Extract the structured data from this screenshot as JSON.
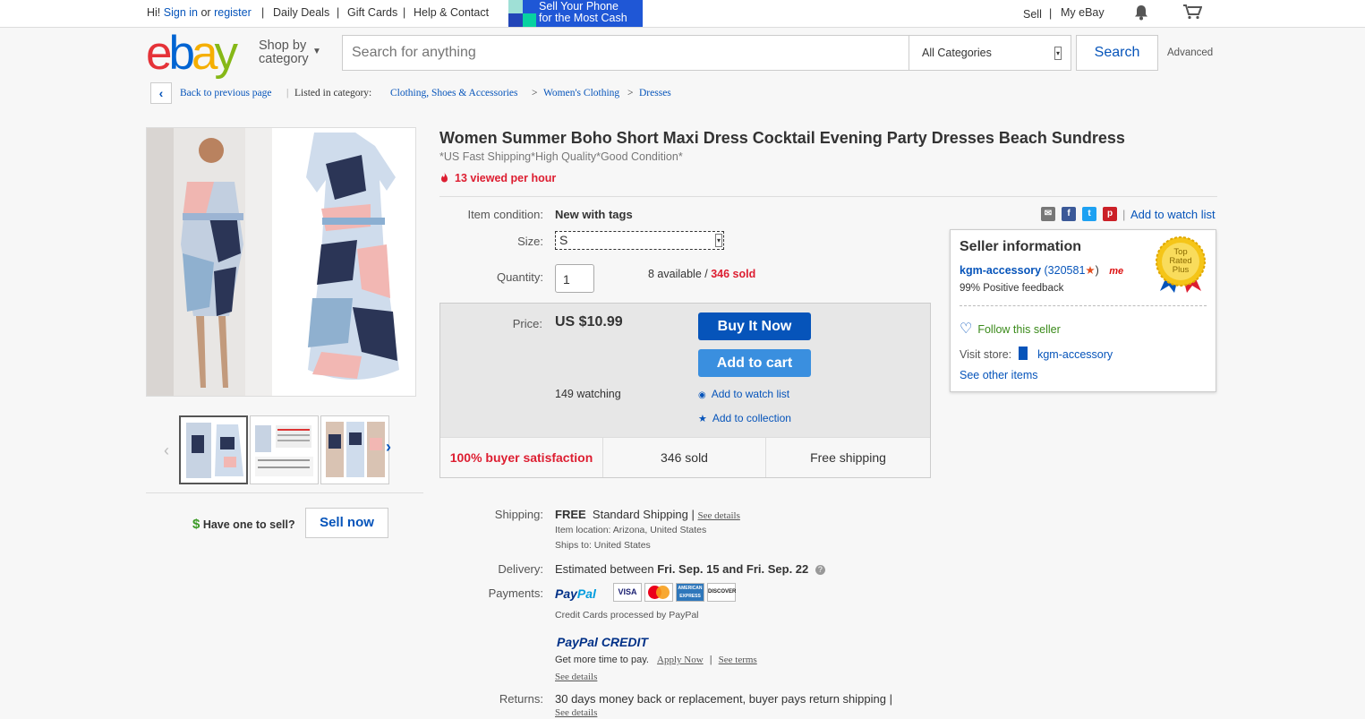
{
  "topbar": {
    "greeting": "Hi!",
    "sign_in": "Sign in",
    "or": "or",
    "register": "register",
    "links": [
      "Daily Deals",
      "Gift Cards",
      "Help & Contact"
    ],
    "banner": "Sell Your Phone for the Most Cash",
    "banner_line1": "Sell Your Phone",
    "banner_line2": "for the Most Cash",
    "sell": "Sell",
    "my_ebay": "My eBay"
  },
  "header": {
    "logo": "ebay",
    "shop_by_1": "Shop by",
    "shop_by_2": "category",
    "search_placeholder": "Search for anything",
    "category": "All Categories",
    "search_button": "Search",
    "advanced": "Advanced"
  },
  "breadcrumb": {
    "back": "Back to previous page",
    "listed_in": "Listed in category:",
    "items": [
      "Clothing, Shoes & Accessories",
      "Women's Clothing",
      "Dresses"
    ]
  },
  "gallery": {
    "have_one": "Have one to sell?",
    "sell_now": "Sell now"
  },
  "item": {
    "title": "Women Summer Boho Short Maxi Dress Cocktail Evening Party Dresses Beach Sundress",
    "subtitle": "*US Fast Shipping*High Quality*Good Condition*",
    "viewed": "13 viewed per hour",
    "condition_label": "Item condition:",
    "condition": "New with tags",
    "size_label": "Size:",
    "size_value": "S",
    "quantity_label": "Quantity:",
    "quantity": "1",
    "available": "8 available",
    "slash": "/",
    "sold": "346 sold",
    "watch_list_top": "Add to watch list"
  },
  "buybox": {
    "price_label": "Price:",
    "price": "US $10.99",
    "buy_now": "Buy It Now",
    "add_cart": "Add to cart",
    "watching": "149 watching",
    "add_watch": "Add to watch list",
    "add_collection": "Add to collection",
    "satisfaction": "100% buyer satisfaction",
    "sold": "346 sold",
    "free_shipping": "Free shipping"
  },
  "seller": {
    "heading": "Seller information",
    "name": "kgm-accessory",
    "score": "(320581",
    "score_close": ")",
    "me": "me",
    "feedback": "99% Positive feedback",
    "badge_1": "Top",
    "badge_2": "Rated",
    "badge_3": "Plus",
    "follow": "Follow this seller",
    "visit_store": "Visit store:",
    "store": "kgm-accessory",
    "see_other": "See other items"
  },
  "details": {
    "shipping_label": "Shipping:",
    "shipping_free": "FREE",
    "shipping_method": "Standard Shipping |",
    "see_details": "See details",
    "item_location": "Item location:  Arizona, United States",
    "ships_to": "Ships to:  United States",
    "delivery_label": "Delivery:",
    "delivery_text": "Estimated between",
    "delivery_dates": "Fri. Sep. 15 and Fri. Sep. 22",
    "payments_label": "Payments:",
    "paypal": "PayPal",
    "cards": [
      "VISA",
      "MasterCard",
      "AMERICAN EXPRESS",
      "DISCOVER"
    ],
    "credit_processed": "Credit Cards processed by PayPal",
    "paypal_credit": "PayPal CREDIT",
    "more_time": "Get more time to pay.",
    "apply_now": "Apply Now",
    "see_terms": "See terms",
    "returns_label": "Returns:",
    "returns_text": "30 days money back or replacement, buyer pays return shipping |"
  },
  "colors": {
    "link": "#0654ba",
    "red": "#dd1e31",
    "buy": "#0654ba",
    "cart": "#3a8fdf"
  }
}
